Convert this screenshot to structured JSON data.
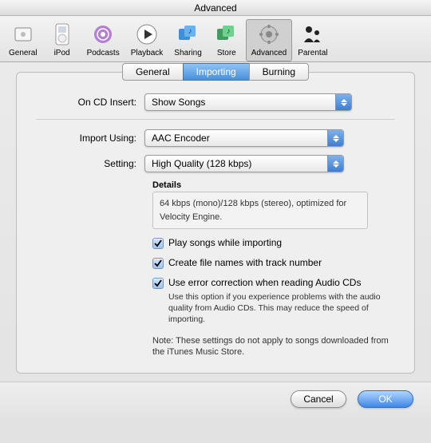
{
  "window": {
    "title": "Advanced"
  },
  "toolbar": {
    "items": [
      {
        "label": "General"
      },
      {
        "label": "iPod"
      },
      {
        "label": "Podcasts"
      },
      {
        "label": "Playback"
      },
      {
        "label": "Sharing"
      },
      {
        "label": "Store"
      },
      {
        "label": "Advanced"
      },
      {
        "label": "Parental"
      }
    ]
  },
  "tabs": {
    "general": "General",
    "importing": "Importing",
    "burning": "Burning"
  },
  "form": {
    "on_cd_insert": {
      "label": "On CD Insert:",
      "value": "Show Songs"
    },
    "import_using": {
      "label": "Import Using:",
      "value": "AAC Encoder"
    },
    "setting": {
      "label": "Setting:",
      "value": "High Quality (128 kbps)"
    },
    "details_title": "Details",
    "details_text": "64 kbps (mono)/128 kbps (stereo), optimized for Velocity Engine.",
    "check_play": "Play songs while importing",
    "check_filenames": "Create file names with track number",
    "check_error": "Use error correction when reading Audio CDs",
    "error_help": "Use this option if you experience problems with the audio quality from Audio CDs. This may reduce the speed of importing.",
    "note": "Note: These settings do not apply to songs downloaded from the iTunes Music Store."
  },
  "buttons": {
    "cancel": "Cancel",
    "ok": "OK"
  }
}
